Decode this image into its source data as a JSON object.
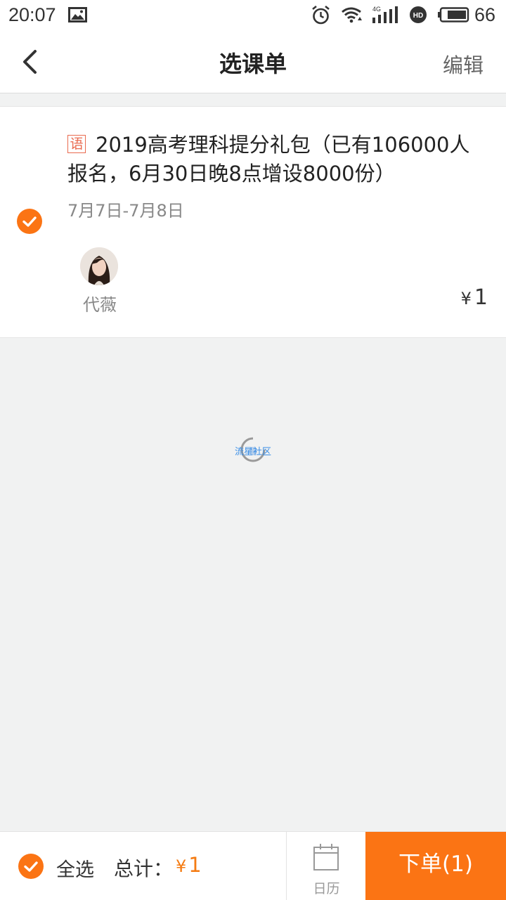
{
  "status_bar": {
    "time": "20:07",
    "battery_level": "66",
    "network_type": "4G",
    "icons": [
      "gallery-icon",
      "alarm-icon",
      "wifi-icon",
      "signal-icon",
      "hd-icon",
      "battery-icon"
    ]
  },
  "header": {
    "title": "选课单",
    "edit_label": "编辑",
    "back_icon": "chevron-left-icon"
  },
  "course": {
    "selected": true,
    "subject_tag": "语",
    "title": "2019高考理科提分礼包（已有106000人报名，6月30日晚8点增设8000份）",
    "dates": "7月7日-7月8日",
    "teacher_name": "代薇",
    "price_symbol": "¥",
    "price": "1"
  },
  "watermark": {
    "text": "流星社区"
  },
  "bottom_bar": {
    "select_all_label": "全选",
    "total_label": "总计：",
    "total_symbol": "¥",
    "total_price": "1",
    "calendar_label": "日历",
    "order_label": "下单(1)"
  },
  "colors": {
    "accent": "#fb7414",
    "price": "#f47b12",
    "subject_tag": "#e96a4f",
    "background": "#f1f2f2"
  }
}
